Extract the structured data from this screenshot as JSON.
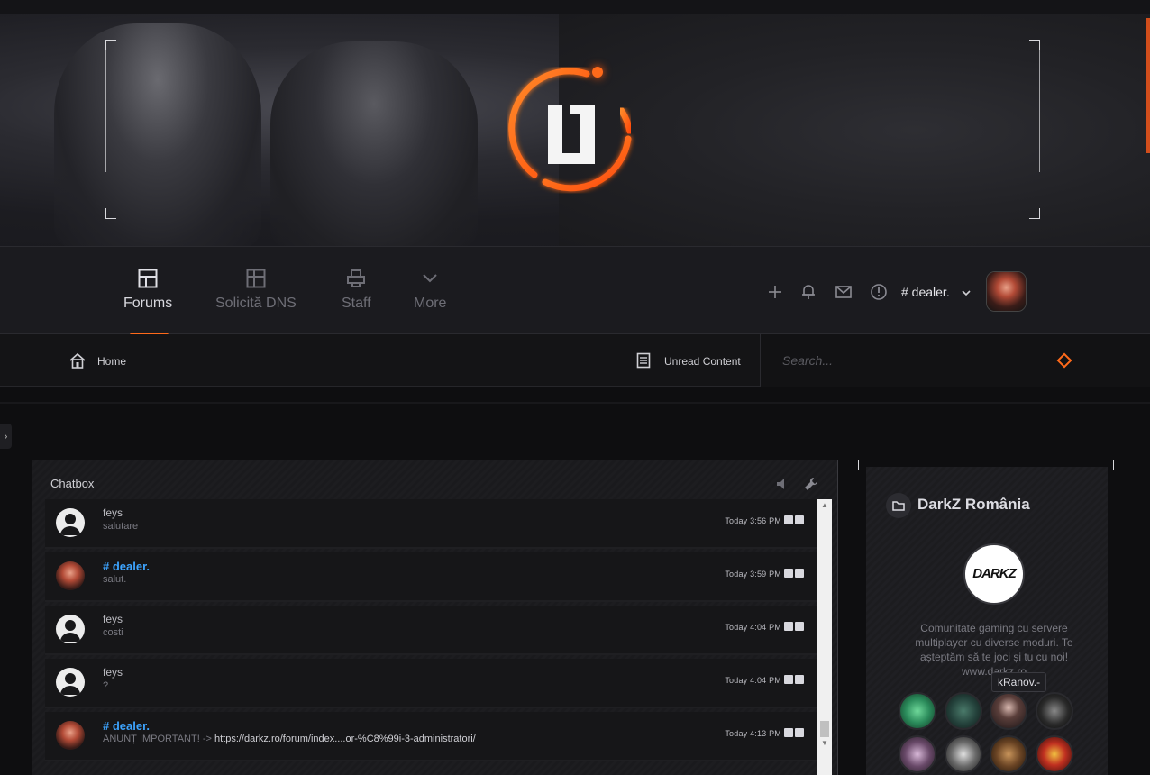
{
  "nav": {
    "items": [
      {
        "label": "Forums",
        "active": true
      },
      {
        "label": "Solicită DNS",
        "active": false
      },
      {
        "label": "Staff",
        "active": false
      },
      {
        "label": "More",
        "active": false
      }
    ],
    "accent_color": "#ff6a1a"
  },
  "user": {
    "name": "# dealer."
  },
  "subbar": {
    "home": "Home",
    "unread": "Unread Content",
    "search_placeholder": "Search..."
  },
  "chatbox": {
    "title": "Chatbox",
    "messages": [
      {
        "author": "feys",
        "text": "salutare",
        "time": "Today 3:56 PM",
        "author_color": "#bdbdc3"
      },
      {
        "author": "# dealer.",
        "text": "salut.",
        "time": "Today 3:59 PM",
        "author_color": "#3da4ff"
      },
      {
        "author": "feys",
        "text": "costi",
        "time": "Today 4:04 PM",
        "author_color": "#bdbdc3"
      },
      {
        "author": "feys",
        "text": "?",
        "time": "Today 4:04 PM",
        "author_color": "#bdbdc3"
      },
      {
        "author": "# dealer.",
        "text": "ANUNȚ IMPORTANT! -> ",
        "link": "https://darkz.ro/forum/index....or-%C8%99i-3-administratori/",
        "time": "Today 4:13 PM",
        "author_color": "#3da4ff"
      }
    ]
  },
  "sidebar": {
    "title": "DarkZ România",
    "logo_text": "DARKZ",
    "description": "Comunitate gaming cu servere multiplayer cu diverse moduri. Te așteptăm să te joci și tu cu noi! www.darkz.ro",
    "tooltip": "kRanov.-"
  }
}
